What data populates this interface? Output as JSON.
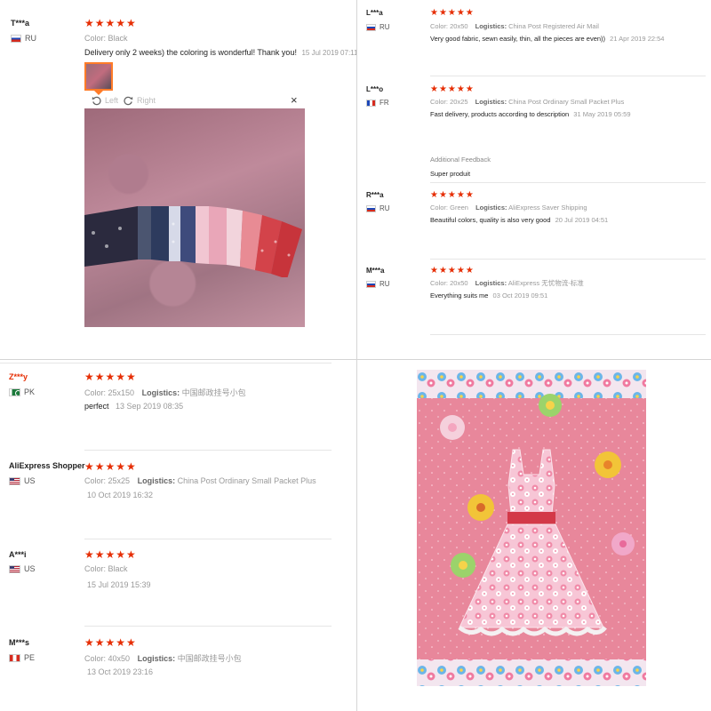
{
  "top_left": {
    "review": {
      "name": "T***a",
      "country": "RU",
      "stars": "★★★★★",
      "color_label": "Color:",
      "color_value": "Black",
      "text": "Delivery only 2 weeks) the coloring is wonderful! Thank you!",
      "date": "15 Jul 2019 07:11"
    },
    "viewer": {
      "left_label": "Left",
      "right_label": "Right",
      "close": "×"
    }
  },
  "top_right": {
    "reviews": [
      {
        "name": "L***a",
        "country": "RU",
        "stars": "★★★★★",
        "color_label": "Color:",
        "color_value": "20x50",
        "logistics_label": "Logistics:",
        "logistics_value": "China Post Registered Air Mail",
        "text": "Very good fabric, sewn easily, thin, all the pieces are even))",
        "date": "21 Apr 2019 22:54"
      },
      {
        "name": "L***o",
        "country": "FR",
        "stars": "★★★★★",
        "color_label": "Color:",
        "color_value": "20x25",
        "logistics_label": "Logistics:",
        "logistics_value": "China Post Ordinary Small Packet Plus",
        "text": "Fast delivery, products according to description",
        "date": "31 May 2019 05:59",
        "additional_label": "Additional Feedback",
        "additional_text": "Super produit"
      },
      {
        "name": "R***a",
        "country": "RU",
        "stars": "★★★★★",
        "color_label": "Color:",
        "color_value": "Green",
        "logistics_label": "Logistics:",
        "logistics_value": "AliExpress Saver Shipping",
        "text": "Beautiful colors, quality is also very good",
        "date": "20 Jul 2019 04:51"
      },
      {
        "name": "M***a",
        "country": "RU",
        "stars": "★★★★★",
        "color_label": "Color:",
        "color_value": "20x50",
        "logistics_label": "Logistics:",
        "logistics_value": "AliExpress 无忧物流-标准",
        "text": "Everything suits me",
        "date": "03 Oct 2019 09:51"
      }
    ]
  },
  "bottom_left": {
    "reviews": [
      {
        "name": "Z***y",
        "country": "PK",
        "stars": "★★★★★",
        "color_label": "Color:",
        "color_value": "25x150",
        "logistics_label": "Logistics:",
        "logistics_value": "中国邮政挂号小包",
        "text": "perfect",
        "date": "13 Sep 2019 08:35"
      },
      {
        "name": "AliExpress Shopper",
        "country": "US",
        "stars": "★★★★★",
        "color_label": "Color:",
        "color_value": "25x25",
        "logistics_label": "Logistics:",
        "logistics_value": "China Post Ordinary Small Packet Plus",
        "text": "",
        "date": "10 Oct 2019 16:32"
      },
      {
        "name": "A***i",
        "country": "US",
        "stars": "★★★★★",
        "color_label": "Color:",
        "color_value": "Black",
        "text": "",
        "date": "15 Jul 2019 15:39"
      },
      {
        "name": "M***s",
        "country": "PE",
        "stars": "★★★★★",
        "color_label": "Color:",
        "color_value": "40x50",
        "logistics_label": "Logistics:",
        "logistics_value": "中国邮政挂号小包",
        "text": "",
        "date": "13 Oct 2019 23:16"
      }
    ]
  },
  "colors": {
    "star": "#e62e04",
    "accent": "#ff7c28",
    "divider": "#d5d5d5",
    "name_highlight": "#e62e04"
  },
  "icons": [
    "rotate-left-icon",
    "rotate-right-icon",
    "close-icon",
    "flag-icon"
  ]
}
